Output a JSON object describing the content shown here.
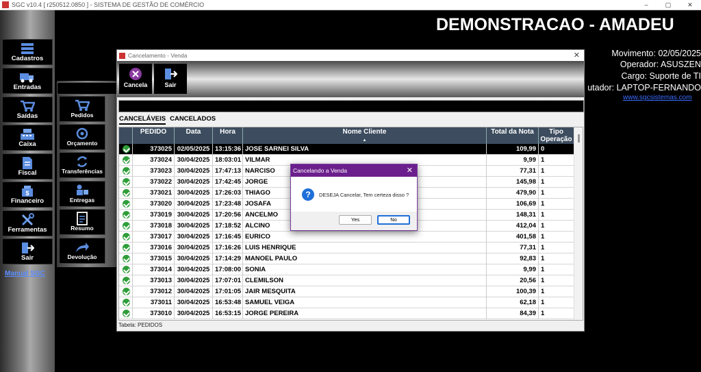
{
  "window": {
    "title": "SGC v10.4 [ r250512.0850 ] - SISTEMA DE GESTÃO DE COMÉRCIO",
    "controls": [
      "–",
      "▢",
      "✕"
    ]
  },
  "sidebar": {
    "items": [
      {
        "label": "Cadastros",
        "icon": "database-icon"
      },
      {
        "label": "Entradas",
        "icon": "truck-icon"
      },
      {
        "label": "Saídas",
        "icon": "cart-icon"
      },
      {
        "label": "Caixa",
        "icon": "register-icon"
      },
      {
        "label": "Fiscal",
        "icon": "document-icon"
      },
      {
        "label": "Financeiro",
        "icon": "money-icon"
      },
      {
        "label": "Ferramentas",
        "icon": "tools-icon"
      },
      {
        "label": "Sair",
        "icon": "exit-icon"
      }
    ],
    "manual_link": "Manual SGC"
  },
  "submenu": {
    "items": [
      {
        "label": "Pedidos",
        "icon": "cart-icon"
      },
      {
        "label": "Orçamento",
        "icon": "budget-icon"
      },
      {
        "label": "Transferências",
        "icon": "transfer-icon"
      },
      {
        "label": "Entregas",
        "icon": "delivery-icon"
      },
      {
        "label": "Resumo",
        "icon": "summary-icon"
      },
      {
        "label": "Devolução",
        "icon": "return-icon"
      }
    ]
  },
  "header": {
    "company": "DEMONSTRACAO - AMADEU",
    "movimento": "Movimento: 02/05/2025",
    "operador": "Operador: ASUSZEN",
    "cargo": "Cargo: Suporte de TI",
    "computador": "utador: LAPTOP-FERNANDO",
    "website": "www.sgcsistemas.com"
  },
  "cancel_window": {
    "title": "Cancelamento - Venda",
    "close": "✕",
    "toolbar": {
      "cancel_label": "Cancela",
      "exit_label": "Sair"
    },
    "tabs": [
      "CANCELÁVEIS",
      "CANCELADOS"
    ],
    "columns": [
      "PEDIDO",
      "Data",
      "Hora",
      "Nome Cliente",
      "Total da Nota",
      "Tipo Operação"
    ],
    "rows": [
      {
        "pedido": "373025",
        "data": "02/05/2025",
        "hora": "13:15:36",
        "cliente": "JOSE SARNEI SILVA",
        "total": "109,99",
        "tipo": "0"
      },
      {
        "pedido": "373024",
        "data": "30/04/2025",
        "hora": "18:03:01",
        "cliente": "VILMAR",
        "total": "9,99",
        "tipo": "1"
      },
      {
        "pedido": "373023",
        "data": "30/04/2025",
        "hora": "17:47:13",
        "cliente": "NARCISO",
        "total": "77,31",
        "tipo": "1"
      },
      {
        "pedido": "373022",
        "data": "30/04/2025",
        "hora": "17:42:45",
        "cliente": "JORGE",
        "total": "145,98",
        "tipo": "1"
      },
      {
        "pedido": "373021",
        "data": "30/04/2025",
        "hora": "17:26:03",
        "cliente": "THIAGO",
        "total": "479,90",
        "tipo": "1"
      },
      {
        "pedido": "373020",
        "data": "30/04/2025",
        "hora": "17:23:48",
        "cliente": "JOSAFA",
        "total": "106,69",
        "tipo": "1"
      },
      {
        "pedido": "373019",
        "data": "30/04/2025",
        "hora": "17:20:56",
        "cliente": "ANCELMO",
        "total": "148,31",
        "tipo": "1"
      },
      {
        "pedido": "373018",
        "data": "30/04/2025",
        "hora": "17:18:52",
        "cliente": "ALCINO",
        "total": "412,04",
        "tipo": "1"
      },
      {
        "pedido": "373017",
        "data": "30/04/2025",
        "hora": "17:16:45",
        "cliente": "EURICO",
        "total": "401,58",
        "tipo": "1"
      },
      {
        "pedido": "373016",
        "data": "30/04/2025",
        "hora": "17:16:26",
        "cliente": "LUIS HENRIQUE",
        "total": "77,31",
        "tipo": "1"
      },
      {
        "pedido": "373015",
        "data": "30/04/2025",
        "hora": "17:14:29",
        "cliente": "MANOEL PAULO",
        "total": "92,83",
        "tipo": "1"
      },
      {
        "pedido": "373014",
        "data": "30/04/2025",
        "hora": "17:08:00",
        "cliente": "SONIA",
        "total": "9,99",
        "tipo": "1"
      },
      {
        "pedido": "373013",
        "data": "30/04/2025",
        "hora": "17:07:01",
        "cliente": "CLEMILSON",
        "total": "20,56",
        "tipo": "1"
      },
      {
        "pedido": "373012",
        "data": "30/04/2025",
        "hora": "17:01:05",
        "cliente": "JAIR MESQUITA",
        "total": "100,39",
        "tipo": "1"
      },
      {
        "pedido": "373011",
        "data": "30/04/2025",
        "hora": "16:53:48",
        "cliente": "SAMUEL VEIGA",
        "total": "62,18",
        "tipo": "1"
      },
      {
        "pedido": "373010",
        "data": "30/04/2025",
        "hora": "16:53:15",
        "cliente": "JORGE PEREIRA",
        "total": "84,39",
        "tipo": "1"
      }
    ],
    "status": "Tabela: PEDIDOS"
  },
  "dialog": {
    "title": "Cancelando a Venda",
    "close": "✕",
    "message": "DESEJA Cancelar, Tem certeza disso ?",
    "icon": "question-icon",
    "yes_label": "Yes",
    "no_label": "No"
  }
}
